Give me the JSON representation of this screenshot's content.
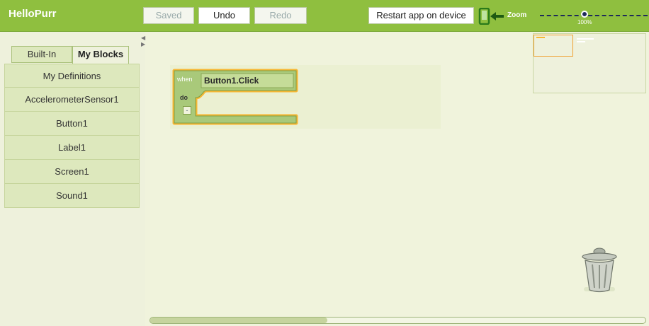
{
  "app": {
    "title": "HelloPurr"
  },
  "toolbar": {
    "saved_label": "Saved",
    "undo_label": "Undo",
    "redo_label": "Redo",
    "restart_label": "Restart app on device",
    "zoom_label": "Zoom",
    "zoom_value": "100%",
    "icon": "device-connect-icon"
  },
  "tabs": [
    {
      "label": "Built-In",
      "active": false
    },
    {
      "label": "My Blocks",
      "active": true
    }
  ],
  "drawers": [
    {
      "label": "My Definitions"
    },
    {
      "label": "AccelerometerSensor1"
    },
    {
      "label": "Button1"
    },
    {
      "label": "Label1"
    },
    {
      "label": "Screen1"
    },
    {
      "label": "Sound1"
    }
  ],
  "block": {
    "keyword_when": "when",
    "event": "Button1.Click",
    "keyword_do": "do",
    "collapse": "-"
  },
  "colors": {
    "topbar": "#8fbf3f",
    "block": "#a9c97a",
    "block_highlight": "#f7b733",
    "workspace": "#f0f3dc"
  }
}
